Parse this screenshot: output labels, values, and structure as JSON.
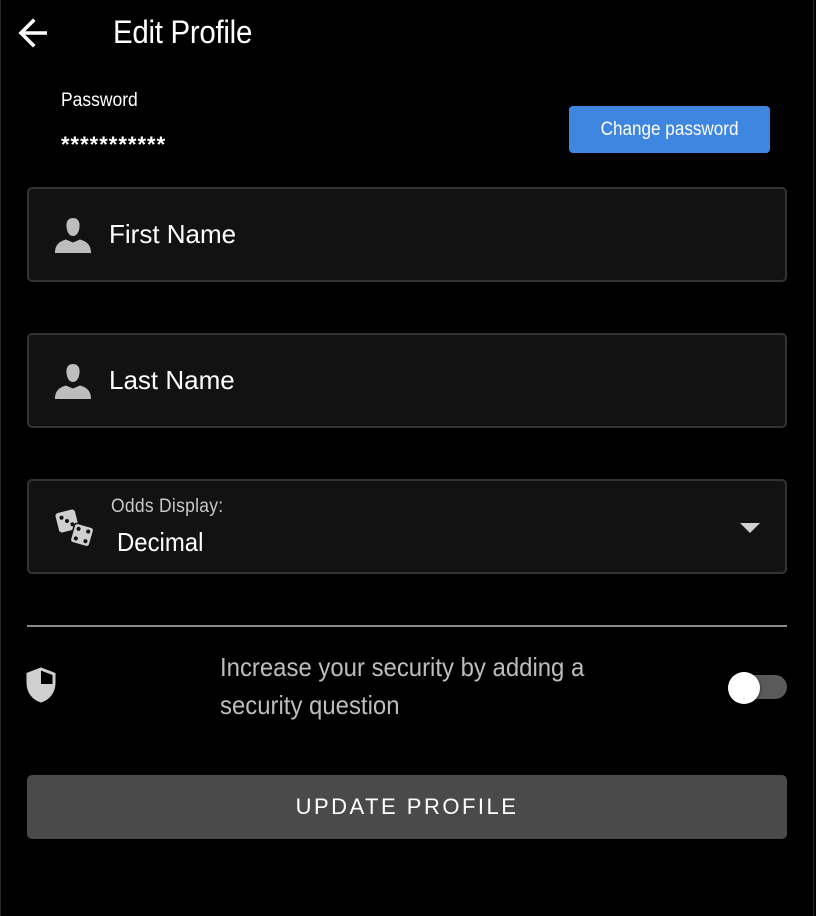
{
  "header": {
    "title": "Edit Profile",
    "back_icon": "arrow-left-icon"
  },
  "password": {
    "label": "Password",
    "value": "***********",
    "change_button_label": "Change password"
  },
  "form": {
    "first_name": {
      "placeholder": "First Name",
      "value": "",
      "icon": "person-icon"
    },
    "last_name": {
      "placeholder": "Last Name",
      "value": "",
      "icon": "person-icon"
    },
    "odds_display": {
      "label": "Odds Display:",
      "selected": "Decimal",
      "icon": "dice-icon"
    }
  },
  "security": {
    "text": "Increase your security by adding a security question",
    "toggle_on": false,
    "icon": "shield-icon"
  },
  "update_button_label": "UPDATE PROFILE",
  "colors": {
    "background": "#000000",
    "field_bg": "#121212",
    "accent_blue": "#3f86e0",
    "update_button_bg": "#4a4a4a"
  }
}
